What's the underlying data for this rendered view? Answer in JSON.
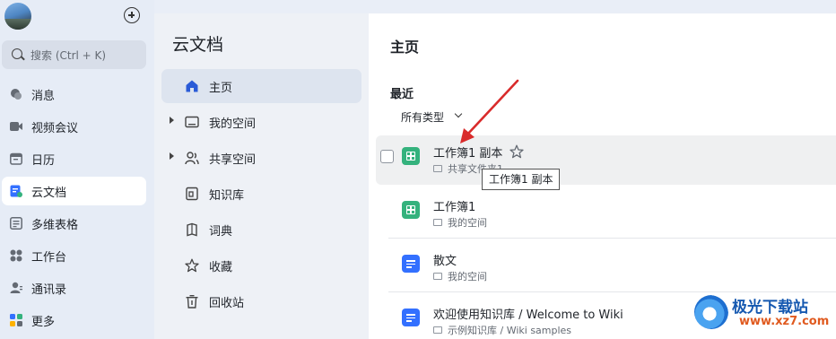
{
  "nav": {
    "search_placeholder": "搜索 (Ctrl + K)",
    "items": [
      {
        "label": "消息",
        "icon": "message-icon"
      },
      {
        "label": "视频会议",
        "icon": "video-icon"
      },
      {
        "label": "日历",
        "icon": "calendar-icon"
      },
      {
        "label": "云文档",
        "icon": "cloud-doc-icon",
        "active": true
      },
      {
        "label": "多维表格",
        "icon": "base-table-icon"
      },
      {
        "label": "工作台",
        "icon": "workplace-icon"
      },
      {
        "label": "通讯录",
        "icon": "contacts-icon"
      },
      {
        "label": "更多",
        "icon": "more-apps-icon"
      }
    ]
  },
  "mid": {
    "title": "云文档",
    "items": [
      {
        "label": "主页",
        "icon": "home-icon",
        "active": true
      },
      {
        "label": "我的空间",
        "icon": "folder-icon",
        "expandable": true
      },
      {
        "label": "共享空间",
        "icon": "shared-users-icon",
        "expandable": true
      },
      {
        "label": "知识库",
        "icon": "wiki-icon"
      },
      {
        "label": "词典",
        "icon": "dictionary-icon"
      },
      {
        "label": "收藏",
        "icon": "star-icon"
      },
      {
        "label": "回收站",
        "icon": "trash-icon"
      }
    ]
  },
  "main": {
    "title": "主页",
    "recent_label": "最近",
    "filter_label": "所有类型",
    "files": [
      {
        "name": "工作簿1 副本",
        "location": "共享文件夹1",
        "type": "sheet",
        "hovered": true
      },
      {
        "name": "工作簿1",
        "location": "我的空间",
        "type": "sheet"
      },
      {
        "name": "散文",
        "location": "我的空间",
        "type": "doc"
      },
      {
        "name": "欢迎使用知识库 / Welcome to Wiki",
        "location": "示例知识库 / Wiki samples",
        "type": "doc"
      }
    ],
    "tooltip": "工作簿1 副本"
  },
  "colors": {
    "accent": "#3370ff",
    "sheet": "#34b27d",
    "annotation_arrow": "#d92b2b"
  },
  "watermark": {
    "name": "极光下载站",
    "url": "www.xz7.com"
  }
}
